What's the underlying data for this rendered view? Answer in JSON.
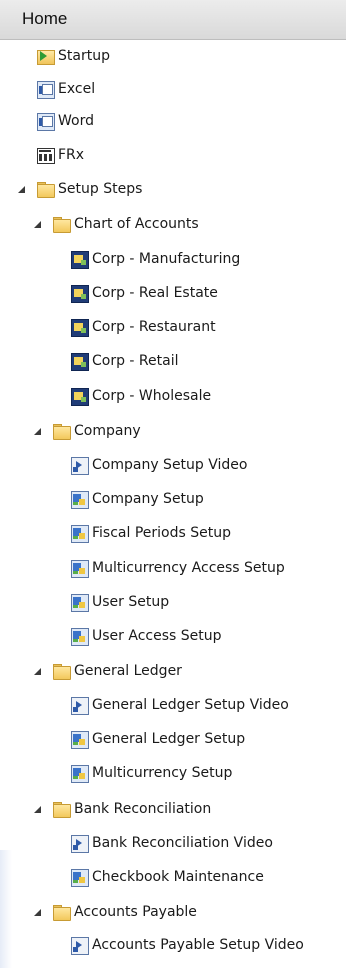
{
  "header": {
    "title": "Home"
  },
  "tree": [
    {
      "label": "Startup",
      "icon": "startup-folder-icon"
    },
    {
      "label": "Excel",
      "icon": "excel-shortcut-icon"
    },
    {
      "label": "Word",
      "icon": "word-shortcut-icon"
    },
    {
      "label": "FRx",
      "icon": "frx-report-icon"
    },
    {
      "label": "Setup Steps",
      "icon": "folder-icon",
      "expanded": true
    },
    {
      "label": "Chart of Accounts",
      "icon": "folder-icon",
      "expanded": true
    },
    {
      "label": "Corp - Manufacturing",
      "icon": "chart-of-accounts-icon"
    },
    {
      "label": "Corp - Real Estate",
      "icon": "chart-of-accounts-icon"
    },
    {
      "label": "Corp - Restaurant",
      "icon": "chart-of-accounts-icon"
    },
    {
      "label": "Corp - Retail",
      "icon": "chart-of-accounts-icon"
    },
    {
      "label": "Corp - Wholesale",
      "icon": "chart-of-accounts-icon"
    },
    {
      "label": "Company",
      "icon": "folder-icon",
      "expanded": true
    },
    {
      "label": "Company Setup Video",
      "icon": "video-icon"
    },
    {
      "label": "Company Setup",
      "icon": "setup-window-icon"
    },
    {
      "label": "Fiscal Periods Setup",
      "icon": "setup-window-icon"
    },
    {
      "label": "Multicurrency Access Setup",
      "icon": "setup-window-icon"
    },
    {
      "label": "User Setup",
      "icon": "setup-window-icon"
    },
    {
      "label": "User Access Setup",
      "icon": "setup-window-icon"
    },
    {
      "label": "General Ledger",
      "icon": "folder-icon",
      "expanded": true
    },
    {
      "label": "General Ledger Setup Video",
      "icon": "video-icon"
    },
    {
      "label": "General Ledger Setup",
      "icon": "setup-window-icon"
    },
    {
      "label": "Multicurrency Setup",
      "icon": "setup-window-icon"
    },
    {
      "label": "Bank Reconciliation",
      "icon": "folder-icon",
      "expanded": true
    },
    {
      "label": "Bank Reconciliation Video",
      "icon": "video-icon"
    },
    {
      "label": "Checkbook Maintenance",
      "icon": "setup-window-icon"
    },
    {
      "label": "Accounts Payable",
      "icon": "folder-icon",
      "expanded": true
    },
    {
      "label": "Accounts Payable Setup Video",
      "icon": "video-icon"
    }
  ]
}
